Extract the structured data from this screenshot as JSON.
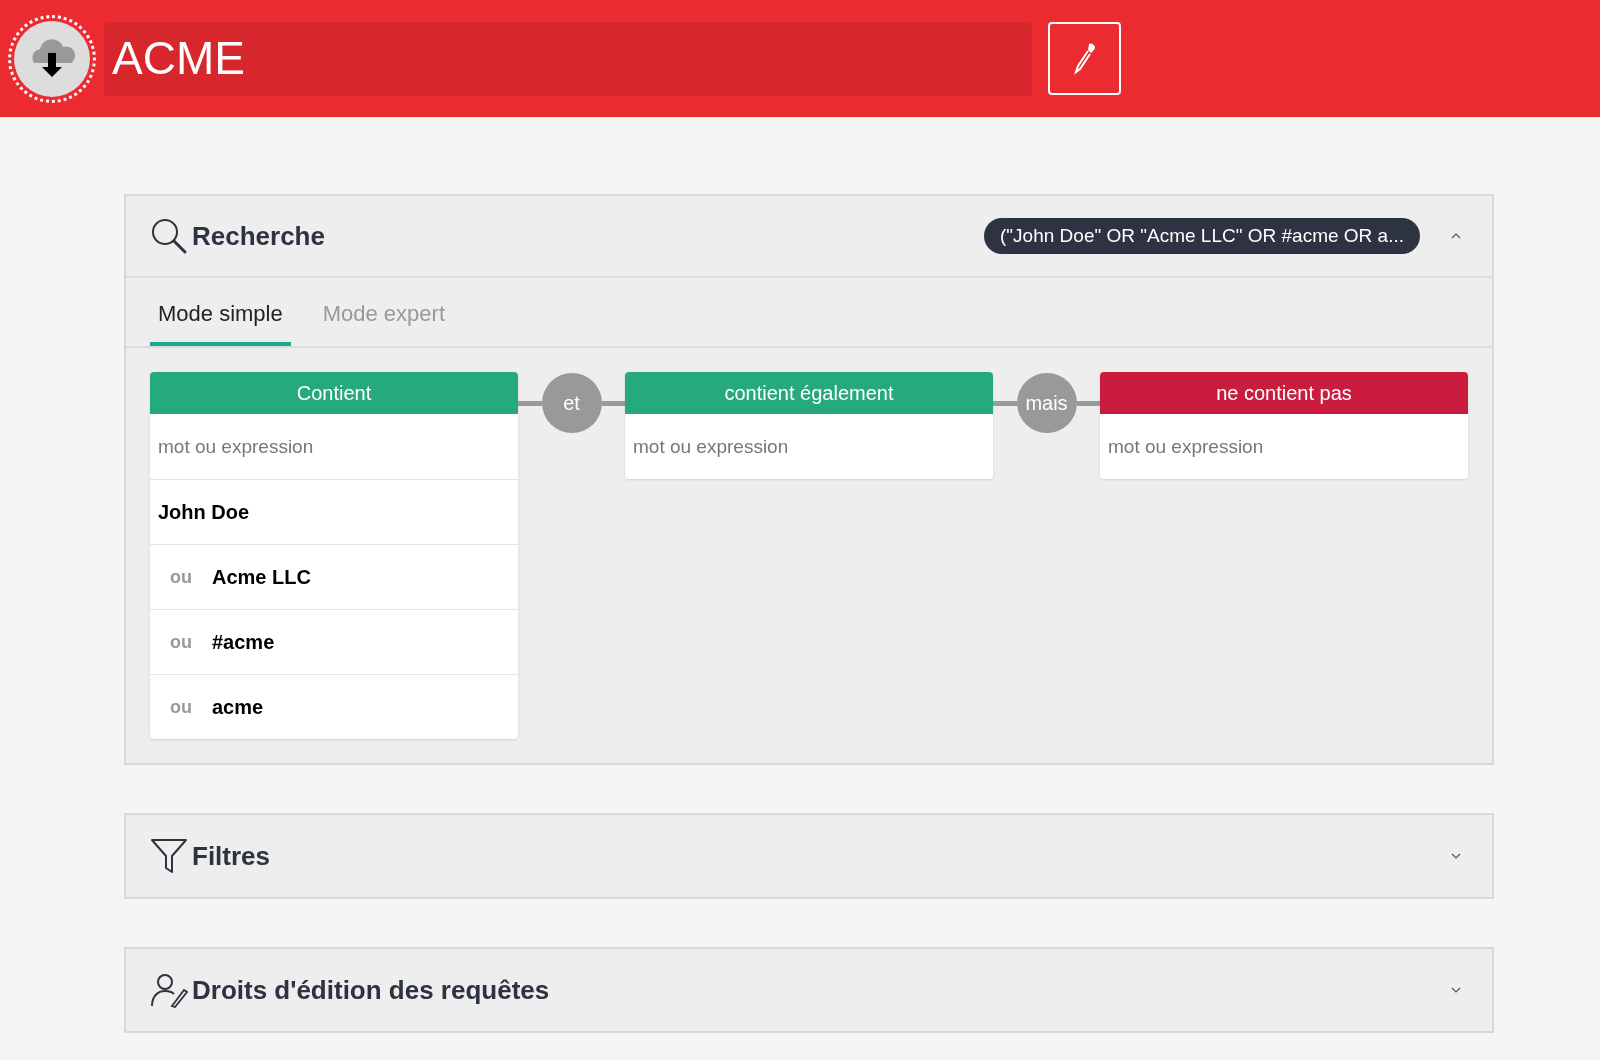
{
  "header": {
    "title": "ACME"
  },
  "search_section": {
    "title": "Recherche",
    "query_badge": "(\"John Doe\" OR \"Acme LLC\" OR #acme OR a...",
    "expanded": true,
    "tabs": [
      {
        "label": "Mode simple",
        "selected": true
      },
      {
        "label": "Mode expert",
        "selected": false
      }
    ],
    "columns": [
      {
        "kind": "include",
        "title": "Contient",
        "placeholder": "mot ou expression",
        "terms": [
          {
            "text": "John Doe"
          },
          {
            "prefix": "ou",
            "text": "Acme LLC"
          },
          {
            "prefix": "ou",
            "text": "#acme"
          },
          {
            "prefix": "ou",
            "text": "acme"
          }
        ]
      },
      {
        "connector": "et",
        "kind": "include",
        "title": "contient également",
        "placeholder": "mot ou expression"
      },
      {
        "connector": "mais",
        "kind": "exclude",
        "title": "ne contient pas",
        "placeholder": "mot ou expression"
      }
    ]
  },
  "other_sections": [
    {
      "kind": "filter",
      "title": "Filtres",
      "expanded": false
    },
    {
      "kind": "rights",
      "title": "Droits d'édition des requêtes",
      "expanded": false
    }
  ]
}
